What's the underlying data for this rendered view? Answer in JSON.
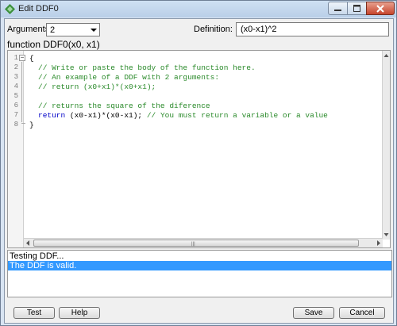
{
  "window": {
    "title": "Edit DDF0"
  },
  "arguments": {
    "label": "Arguments:",
    "value": "2"
  },
  "definition": {
    "label": "Definition:",
    "value": "(x0-x1)^2"
  },
  "function_signature": "function DDF0(x0, x1)",
  "editor": {
    "lines": [
      {
        "num": "1",
        "text": "{"
      },
      {
        "num": "2",
        "text": "// Write or paste the body of the function here."
      },
      {
        "num": "3",
        "text": "// An example of a DDF with 2 arguments:"
      },
      {
        "num": "4",
        "text": "// return (x0+x1)*(x0+x1);"
      },
      {
        "num": "5",
        "text": ""
      },
      {
        "num": "6",
        "text": "// returns the square of the diference"
      },
      {
        "num": "7",
        "kw": "return",
        "code": " (x0-x1)*(x0-x1); ",
        "comment": "// You must return a variable or a value"
      },
      {
        "num": "8",
        "text": "}"
      }
    ]
  },
  "output": {
    "lines": [
      "Testing DDF...",
      "The DDF is valid."
    ]
  },
  "buttons": {
    "test": "Test",
    "help": "Help",
    "save": "Save",
    "cancel": "Cancel"
  }
}
